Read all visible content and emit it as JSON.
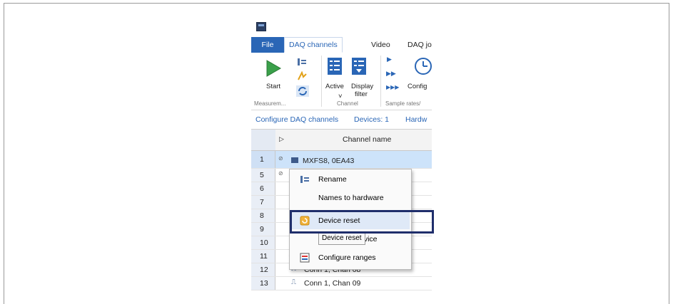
{
  "ribbon": {
    "file_label": "File",
    "tabs": [
      "DAQ channels",
      "Video",
      "DAQ jo"
    ],
    "start_label": "Start",
    "measurement_group": "Measurem...",
    "active_label": "Active",
    "display_label": "Display",
    "filter_label": "filter",
    "config_label": "Config",
    "channel_group": "Channel",
    "sample_rates_group": "Sample rates/"
  },
  "infobar": {
    "configure": "Configure DAQ channels",
    "devices": "Devices: 1",
    "hardware": "Hardw"
  },
  "grid": {
    "column_header": "Channel name",
    "rows": [
      {
        "num": "1",
        "name": "MXFS8, 0EA43"
      },
      {
        "num": "5",
        "name": ""
      },
      {
        "num": "6",
        "name": ""
      },
      {
        "num": "7",
        "name": ""
      },
      {
        "num": "8",
        "name": ""
      },
      {
        "num": "9",
        "name": ""
      },
      {
        "num": "10",
        "name": ""
      },
      {
        "num": "11",
        "name": ""
      },
      {
        "num": "12",
        "name": "Conn 1, Chan 08"
      },
      {
        "num": "13",
        "name": "Conn 1, Chan 09"
      }
    ]
  },
  "context_menu": {
    "items": [
      "Rename",
      "Names to hardware",
      "Device reset",
      "evice",
      "Configure ranges"
    ]
  },
  "tooltip": "Device reset",
  "colors": {
    "accent": "#2a66b6",
    "highlight_border": "#1f2e6b"
  }
}
